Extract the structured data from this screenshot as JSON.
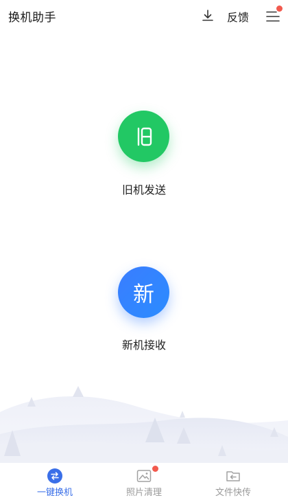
{
  "header": {
    "title": "换机助手",
    "feedback_label": "反馈",
    "download_icon": "download-icon",
    "menu_icon": "hamburger-menu-icon"
  },
  "actions": {
    "old": {
      "glyph": "旧",
      "label": "旧机发送",
      "color": "#22c864"
    },
    "new": {
      "glyph": "新",
      "label": "新机接收",
      "color": "#2f86ff"
    }
  },
  "tabs": [
    {
      "label": "一键换机",
      "icon": "swap-icon",
      "active": true
    },
    {
      "label": "照片清理",
      "icon": "photo-icon",
      "active": false,
      "badge": true
    },
    {
      "label": "文件快传",
      "icon": "folder-transfer-icon",
      "active": false
    }
  ],
  "colors": {
    "accent": "#3a6fe8",
    "badge": "#f25a4e"
  }
}
